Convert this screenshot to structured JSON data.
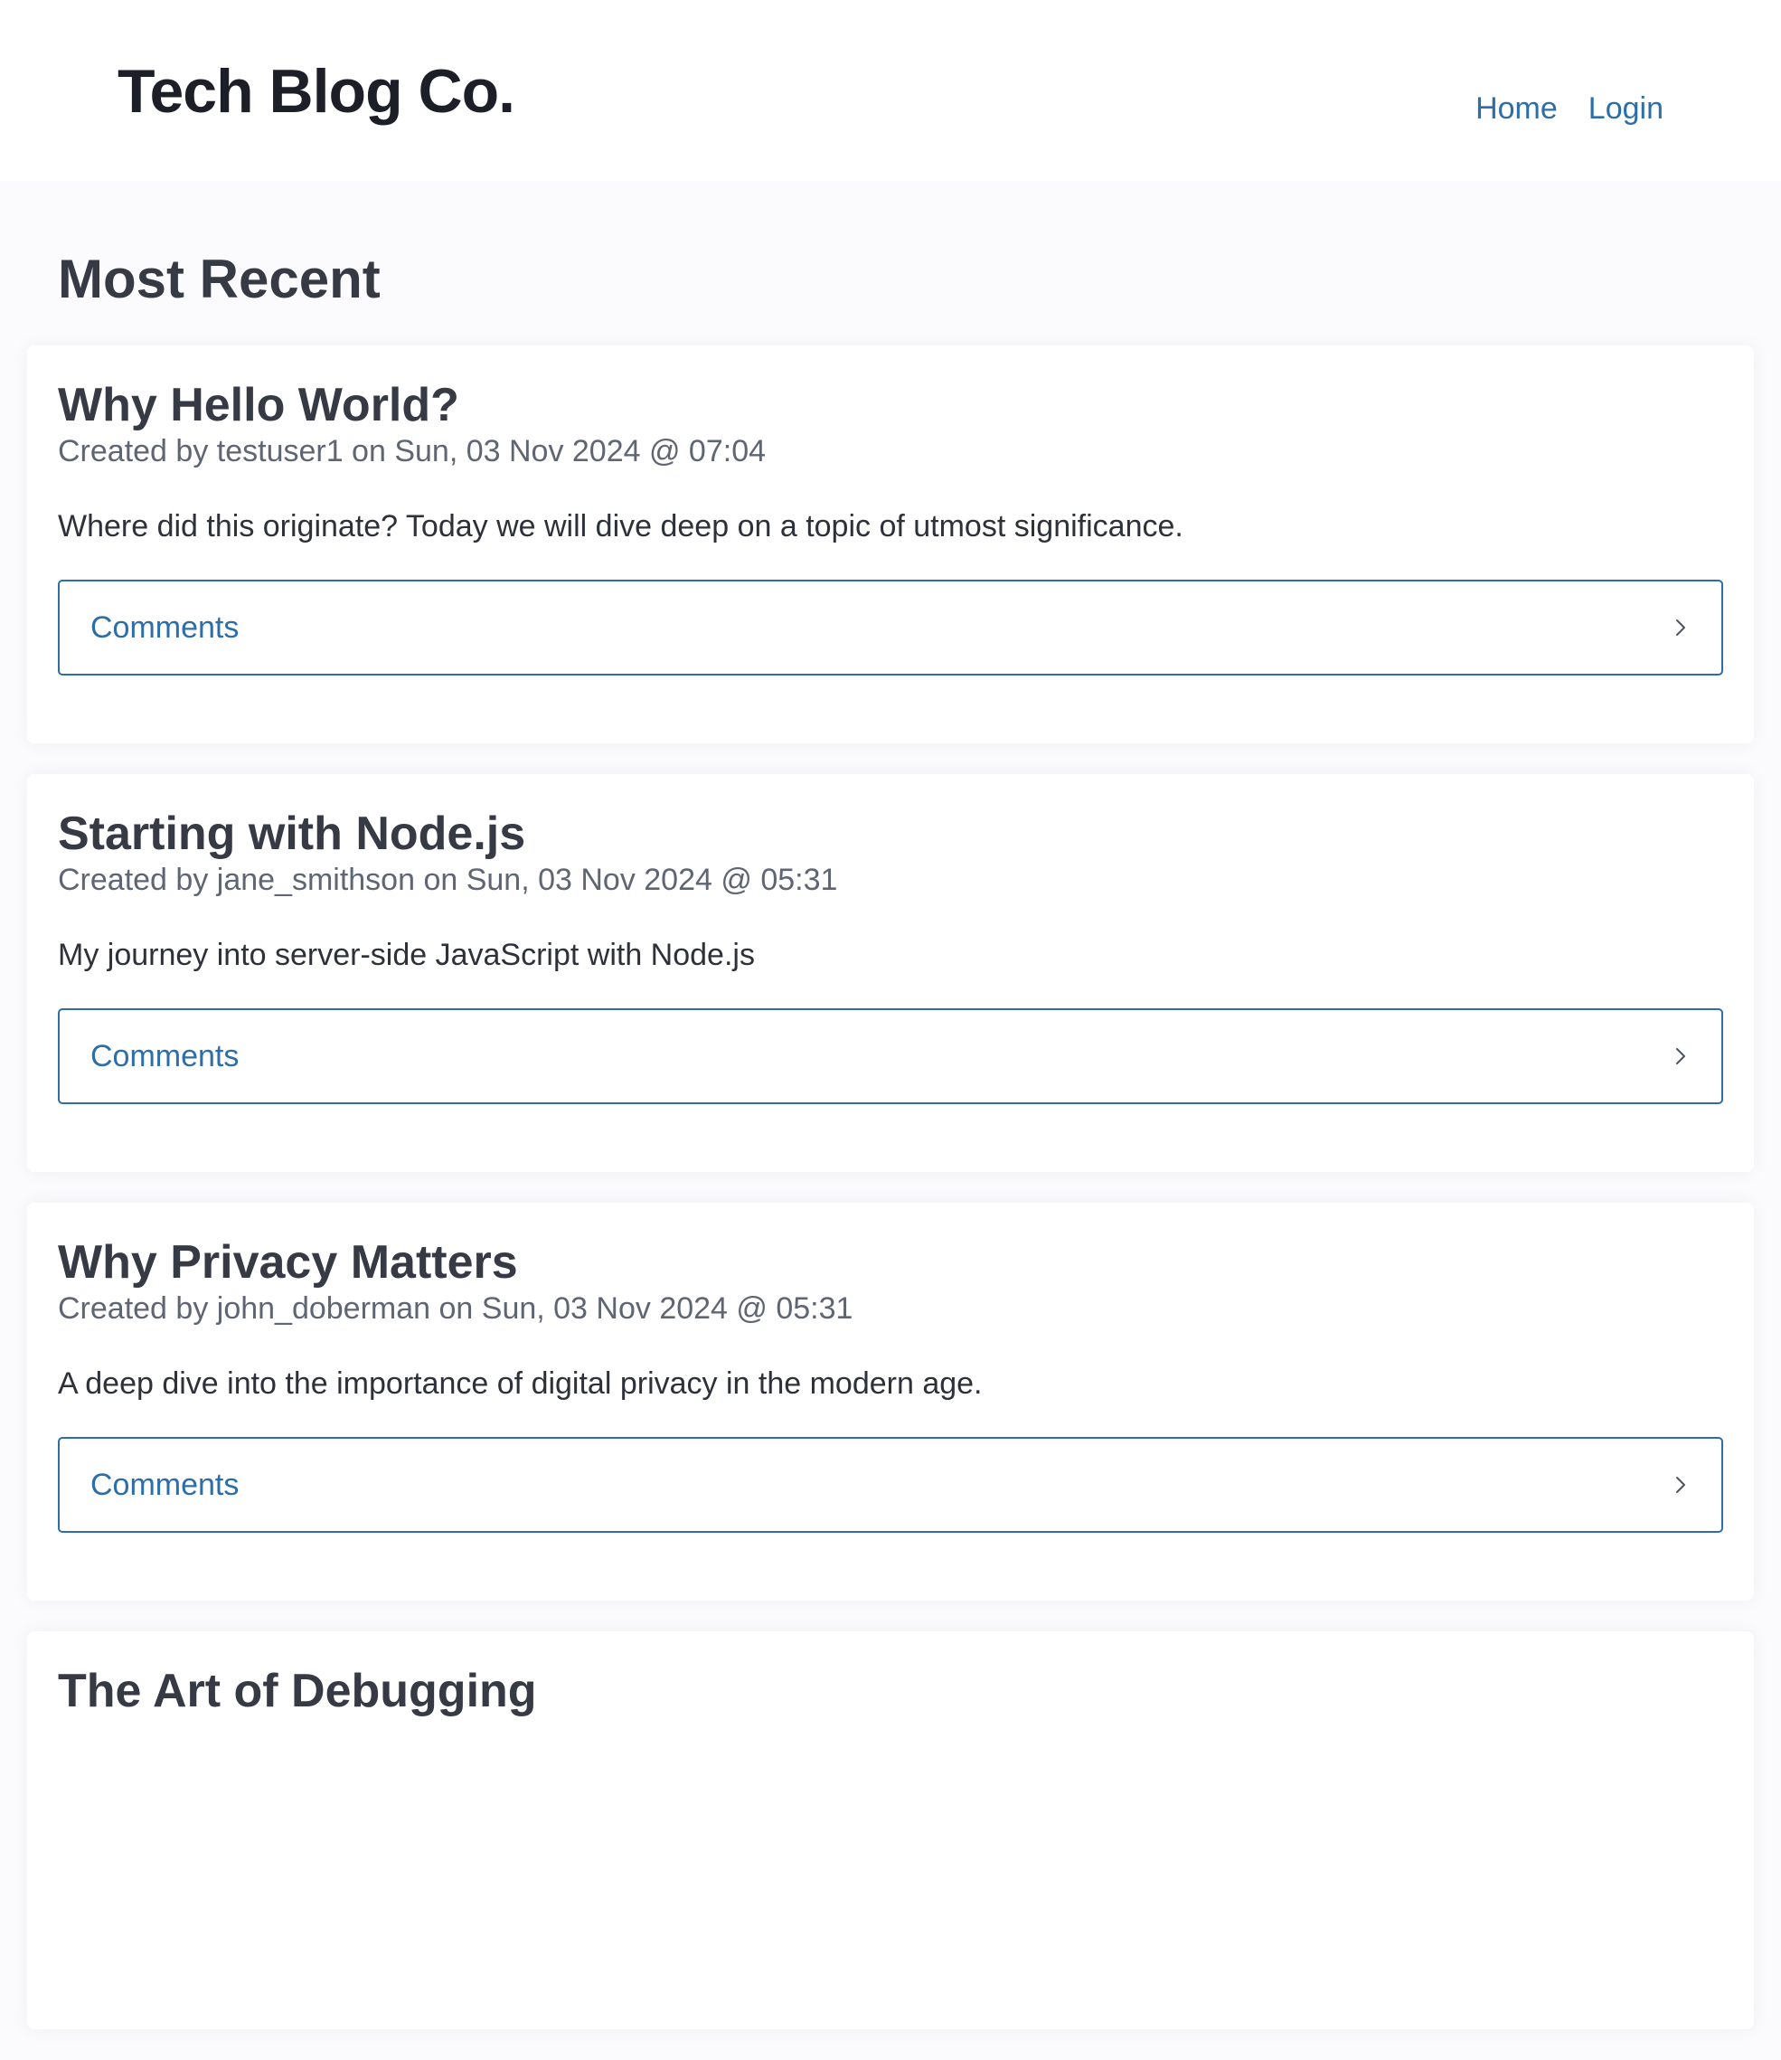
{
  "header": {
    "brand": "Tech Blog Co.",
    "nav": [
      {
        "label": "Home"
      },
      {
        "label": "Login"
      }
    ]
  },
  "main": {
    "section_title": "Most Recent",
    "posts": [
      {
        "title": "Why Hello World?",
        "meta": "Created by testuser1 on Sun, 03 Nov 2024 @ 07:04",
        "body": "Where did this originate? Today we will dive deep on a topic of utmost significance.",
        "comments_label": "Comments"
      },
      {
        "title": "Starting with Node.js",
        "meta": "Created by jane_smithson on Sun, 03 Nov 2024 @ 05:31",
        "body": "My journey into server-side JavaScript with Node.js",
        "comments_label": "Comments"
      },
      {
        "title": "Why Privacy Matters",
        "meta": "Created by john_doberman on Sun, 03 Nov 2024 @ 05:31",
        "body": "A deep dive into the importance of digital privacy in the modern age.",
        "comments_label": "Comments"
      },
      {
        "title": "The Art of Debugging"
      }
    ]
  },
  "colors": {
    "link": "#2d6da8",
    "heading": "#353a45",
    "meta_text": "#5f6673",
    "background": "#fbfbfd"
  }
}
